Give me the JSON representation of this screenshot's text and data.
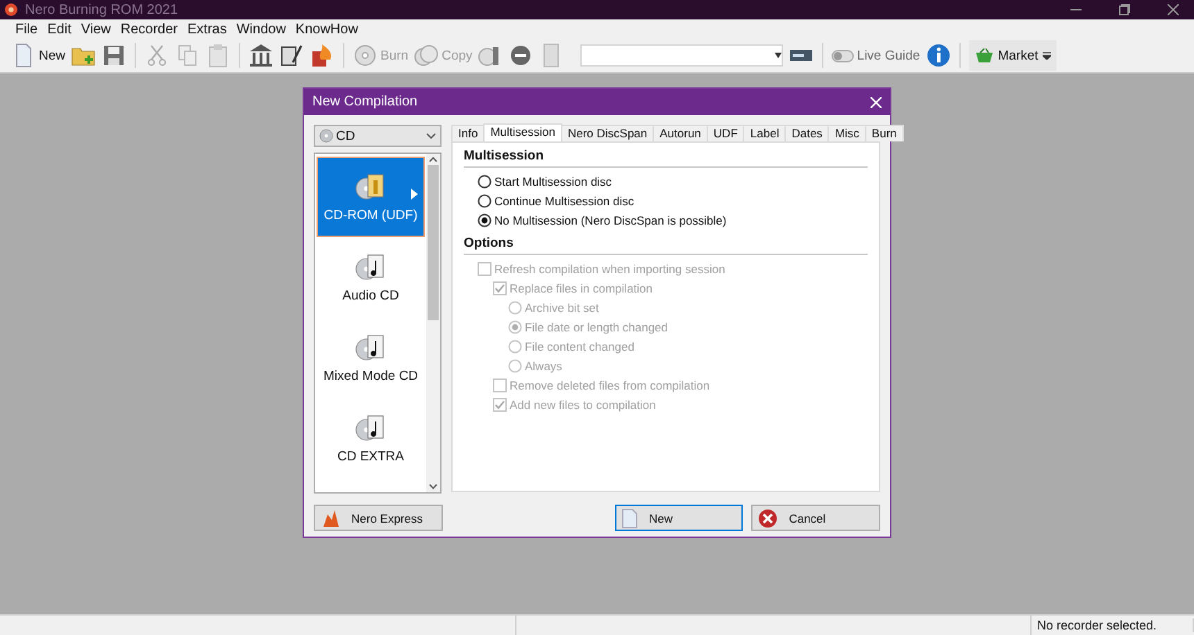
{
  "window": {
    "title": "Nero Burning ROM 2021"
  },
  "menu": [
    "File",
    "Edit",
    "View",
    "Recorder",
    "Extras",
    "Window",
    "KnowHow"
  ],
  "toolbar": {
    "new": "New",
    "burn": {
      "label": "Burn",
      "disabled": true
    },
    "copy": {
      "label": "Copy",
      "disabled": true
    },
    "live_guide": {
      "label": "Live Guide",
      "on": false
    },
    "market": "Market"
  },
  "dialog": {
    "title": "New Compilation",
    "media": {
      "value": "CD"
    },
    "compilations": [
      {
        "label": "CD-ROM (UDF)",
        "selected": true
      },
      {
        "label": "Audio CD",
        "selected": false
      },
      {
        "label": "Mixed Mode CD",
        "selected": false
      },
      {
        "label": "CD EXTRA",
        "selected": false
      }
    ],
    "tabs": [
      {
        "label": "Info",
        "selected": false
      },
      {
        "label": "Multisession",
        "selected": true
      },
      {
        "label": "Nero DiscSpan",
        "selected": false
      },
      {
        "label": "Autorun",
        "selected": false
      },
      {
        "label": "UDF",
        "selected": false
      },
      {
        "label": "Label",
        "selected": false
      },
      {
        "label": "Dates",
        "selected": false
      },
      {
        "label": "Misc",
        "selected": false
      },
      {
        "label": "Burn",
        "selected": false
      }
    ],
    "multisession": {
      "heading": "Multisession",
      "choices": [
        {
          "label": "Start Multisession disc",
          "selected": false
        },
        {
          "label": "Continue Multisession disc",
          "selected": false
        },
        {
          "label": "No Multisession (Nero DiscSpan is possible)",
          "selected": true
        }
      ]
    },
    "options": {
      "heading": "Options",
      "items": [
        {
          "kind": "checkbox",
          "label": "Refresh compilation when importing session",
          "checked": false,
          "disabled": true,
          "children": [
            {
              "kind": "checkbox",
              "label": "Replace files in compilation",
              "checked": true,
              "disabled": true,
              "children": [
                {
                  "kind": "radio",
                  "label": "Archive bit set",
                  "selected": false,
                  "disabled": true
                },
                {
                  "kind": "radio",
                  "label": "File date or length changed",
                  "selected": true,
                  "disabled": true
                },
                {
                  "kind": "radio",
                  "label": "File content changed",
                  "selected": false,
                  "disabled": true
                },
                {
                  "kind": "radio",
                  "label": "Always",
                  "selected": false,
                  "disabled": true
                }
              ]
            },
            {
              "kind": "checkbox",
              "label": "Remove deleted files from compilation",
              "checked": false,
              "disabled": true
            },
            {
              "kind": "checkbox",
              "label": "Add new files to compilation",
              "checked": true,
              "disabled": true
            }
          ]
        }
      ]
    },
    "buttons": {
      "express": "Nero Express",
      "new": {
        "label": "New",
        "default": true
      },
      "cancel": "Cancel"
    }
  },
  "status_bar": {
    "message": "No recorder selected."
  }
}
